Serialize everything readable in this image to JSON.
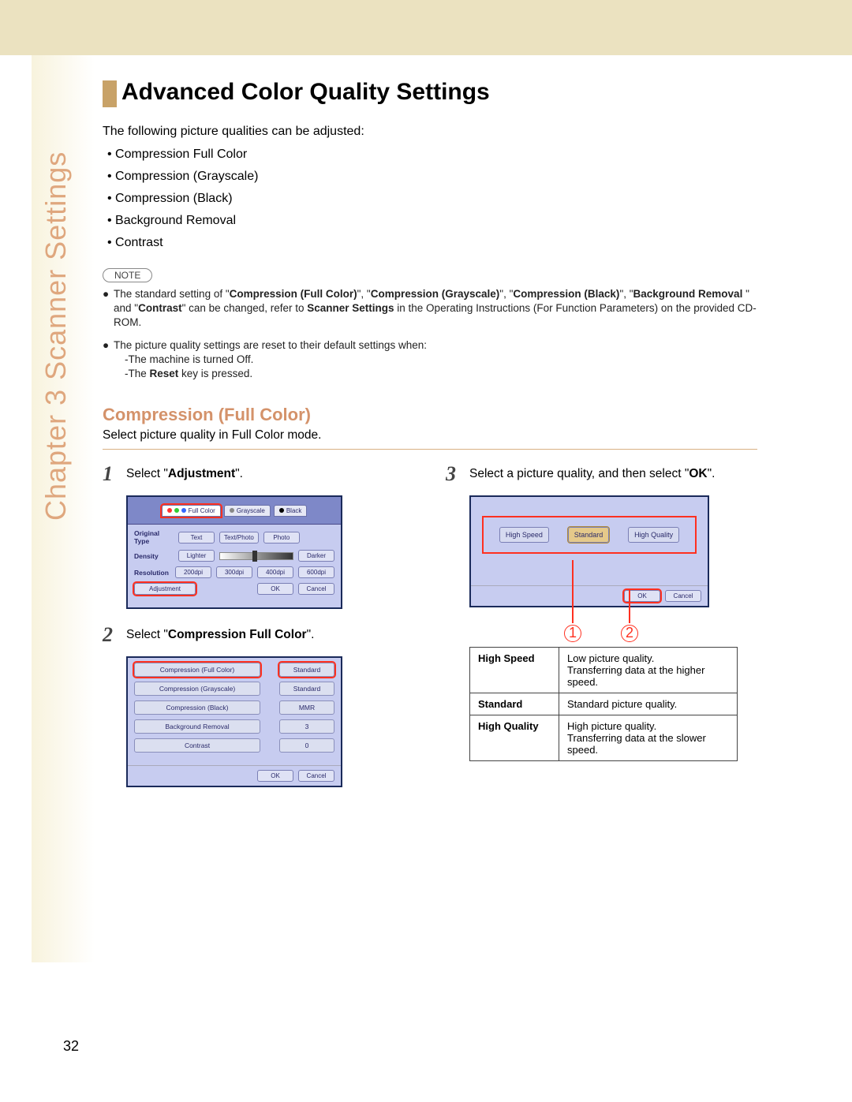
{
  "chapter_label": "Chapter 3    Scanner Settings",
  "main_title": "Advanced Color Quality Settings",
  "intro": "The following picture qualities can be adjusted:",
  "qualities": [
    "Compression Full Color",
    "Compression (Grayscale)",
    "Compression (Black)",
    "Background Removal",
    "Contrast"
  ],
  "note_label": "NOTE",
  "note1_pre": "The standard setting of \"",
  "note1_items": [
    "Compression (Full Color)",
    "Compression (Grayscale)",
    "Compression (Black)",
    "Background Removal",
    "Contrast"
  ],
  "note1_mid1": "\", \"",
  "note1_mid_and": " \" and \"",
  "note1_post1": "\" can be changed, refer to ",
  "note1_scanner": "Scanner Settings",
  "note1_post2": " in the Operating Instructions (For Function Parameters) on the provided CD-ROM.",
  "note2_intro": "The picture quality settings are reset to their default settings when:",
  "note2_a": "-The machine is turned Off.",
  "note2_b_pre": "-The ",
  "note2_b_bold": "Reset",
  "note2_b_post": " key is pressed.",
  "section_title": "Compression (Full Color)",
  "section_desc": "Select picture quality in Full Color mode.",
  "step1_num": "1",
  "step1_text_pre": "Select \"",
  "step1_text_bold": "Adjustment",
  "step1_text_post": "\".",
  "step2_num": "2",
  "step2_text_pre": "Select \"",
  "step2_text_bold": "Compression Full Color",
  "step2_text_post": "\".",
  "step3_num": "3",
  "step3_text_pre": "Select a picture quality, and then select \"",
  "step3_text_bold": "OK",
  "step3_text_post": "\".",
  "panel1": {
    "tabs": [
      "Full Color",
      "Grayscale",
      "Black"
    ],
    "rows": {
      "orig_label": "Original Type",
      "orig_opts": [
        "Text",
        "Text/Photo",
        "Photo"
      ],
      "density_label": "Density",
      "lighter": "Lighter",
      "darker": "Darker",
      "res_label": "Resolution",
      "res_opts": [
        "200dpi",
        "300dpi",
        "400dpi",
        "600dpi"
      ],
      "adjustment": "Adjustment",
      "ok": "OK",
      "cancel": "Cancel"
    }
  },
  "panel2": {
    "rows": [
      {
        "name": "Compression (Full Color)",
        "val": "Standard"
      },
      {
        "name": "Compression (Grayscale)",
        "val": "Standard"
      },
      {
        "name": "Compression (Black)",
        "val": "MMR"
      },
      {
        "name": "Background Removal",
        "val": "3"
      },
      {
        "name": "Contrast",
        "val": "0"
      }
    ],
    "ok": "OK",
    "cancel": "Cancel"
  },
  "panel3": {
    "opts": [
      "High Speed",
      "Standard",
      "High Quality"
    ],
    "ok": "OK",
    "cancel": "Cancel"
  },
  "callout1": "1",
  "callout2": "2",
  "qtable": [
    {
      "h": "High Speed",
      "d": "Low picture quality.\nTransferring data at the higher speed."
    },
    {
      "h": "Standard",
      "d": "Standard picture quality."
    },
    {
      "h": "High Quality",
      "d": "High picture quality.\nTransferring data at the slower speed."
    }
  ],
  "page_number": "32"
}
